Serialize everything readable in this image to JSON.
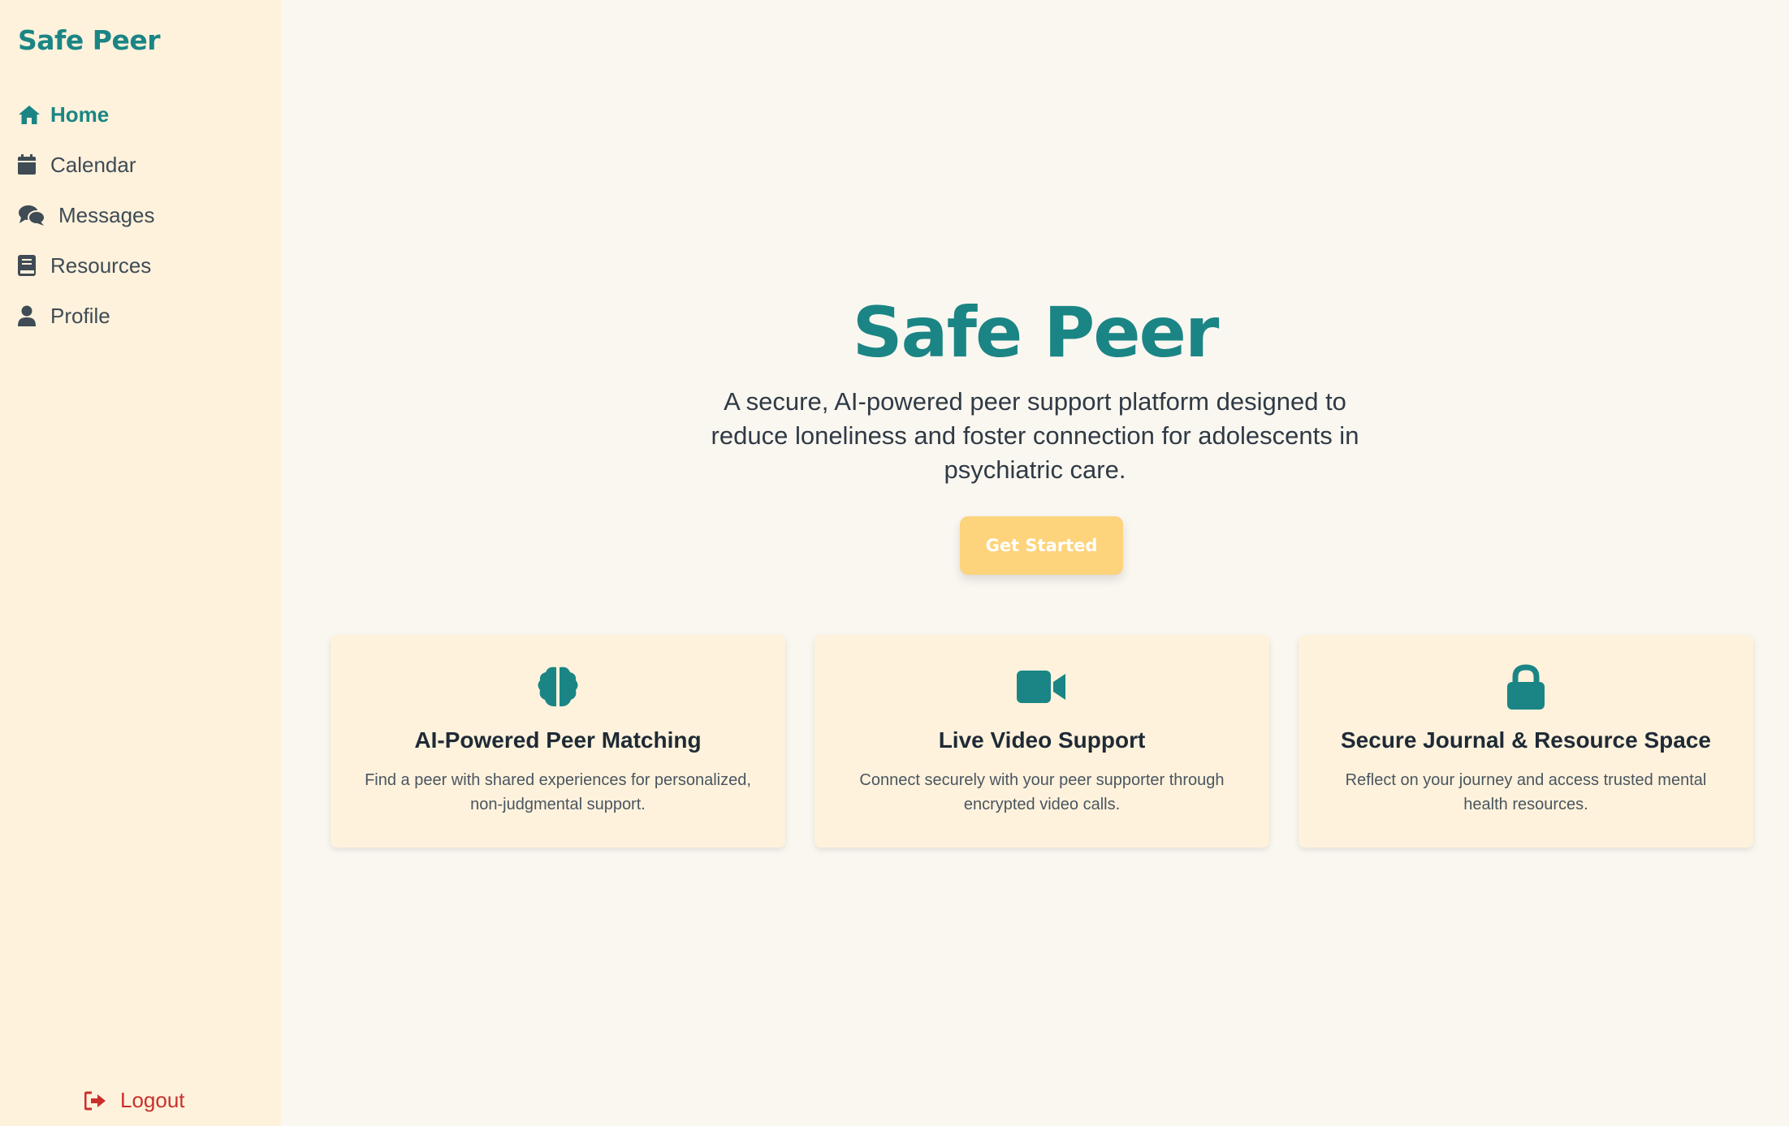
{
  "sidebar": {
    "brand": "Safe Peer",
    "items": [
      {
        "label": "Home",
        "icon": "home-icon",
        "active": true
      },
      {
        "label": "Calendar",
        "icon": "calendar-icon",
        "active": false
      },
      {
        "label": "Messages",
        "icon": "chat-icon",
        "active": false
      },
      {
        "label": "Resources",
        "icon": "book-icon",
        "active": false
      },
      {
        "label": "Profile",
        "icon": "user-icon",
        "active": false
      }
    ],
    "logout_label": "Logout"
  },
  "hero": {
    "title": "Safe Peer",
    "subtitle": "A secure, AI-powered peer support platform designed to reduce loneliness and foster connection for adolescents in psychiatric care.",
    "cta_label": "Get Started"
  },
  "features": [
    {
      "icon": "brain-icon",
      "title": "AI-Powered Peer Matching",
      "description": "Find a peer with shared experiences for personalized, non-judgmental support."
    },
    {
      "icon": "video-camera-icon",
      "title": "Live Video Support",
      "description": "Connect securely with your peer supporter through encrypted video calls."
    },
    {
      "icon": "lock-icon",
      "title": "Secure Journal & Resource Space",
      "description": "Reflect on your journey and access trusted mental health resources."
    }
  ],
  "colors": {
    "brand_teal": "#1b8585",
    "sidebar_bg": "#fef2dc",
    "page_bg": "#faf7f0",
    "cta_bg": "#fdd37c",
    "logout_red": "#c9302c"
  }
}
